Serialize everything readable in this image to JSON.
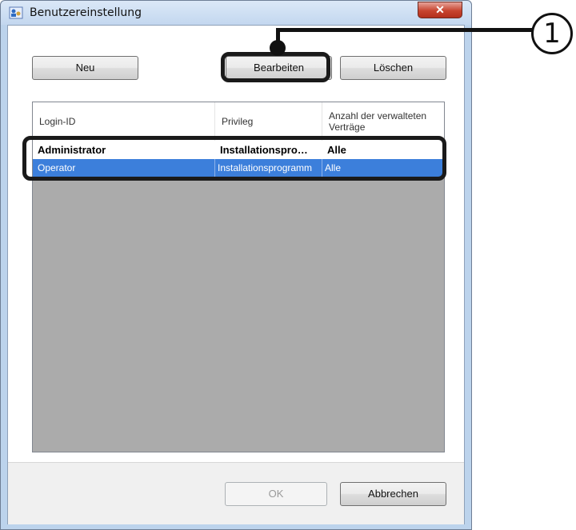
{
  "window": {
    "title": "Benutzereinstellung",
    "close_glyph": "✕"
  },
  "toolbar": {
    "new_label": "Neu",
    "edit_label": "Bearbeiten",
    "delete_label": "Löschen"
  },
  "list": {
    "columns": [
      "Login-ID",
      "Privileg",
      "Anzahl der verwalteten Verträge"
    ],
    "rows": [
      {
        "login_id": "Administrator",
        "privilege": "Installationspro…",
        "contracts": "Alle"
      },
      {
        "login_id": "Operator",
        "privilege": "Installationsprogramm",
        "contracts": "Alle"
      }
    ]
  },
  "footer": {
    "ok_label": "OK",
    "cancel_label": "Abbrechen"
  },
  "callout": {
    "number": "1"
  }
}
